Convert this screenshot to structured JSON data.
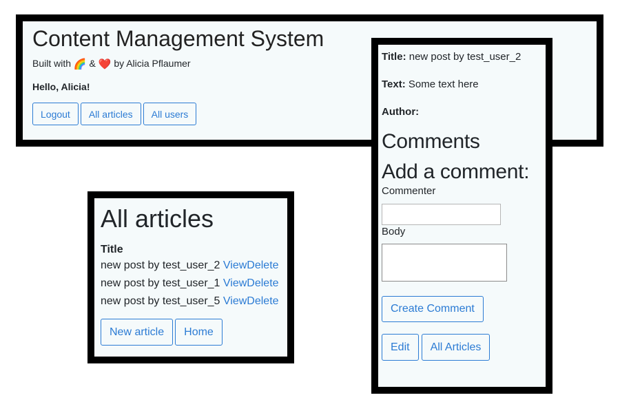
{
  "header": {
    "title": "Content Management System",
    "built_with_prefix": "Built with",
    "rainbow_emoji": "🌈",
    "ampersand": "&",
    "heart_emoji": "❤️",
    "built_with_suffix": "by Alicia Pflaumer",
    "greeting": "Hello, Alicia!",
    "buttons": {
      "logout": "Logout",
      "all_articles": "All articles",
      "all_users": "All users"
    }
  },
  "articles": {
    "heading": "All articles",
    "column_title": "Title",
    "rows": [
      {
        "title": "new post by test_user_2",
        "view": "View",
        "delete": "Delete"
      },
      {
        "title": "new post by test_user_1",
        "view": "View",
        "delete": "Delete"
      },
      {
        "title": "new post by test_user_5",
        "view": "View",
        "delete": "Delete"
      }
    ],
    "buttons": {
      "new_article": "New article",
      "home": "Home"
    }
  },
  "detail": {
    "title_key": "Title:",
    "title_value": "new post by test_user_2",
    "text_key": "Text:",
    "text_value": "Some text here",
    "author_key": "Author:",
    "author_value": "",
    "comments_heading": "Comments",
    "add_comment_heading": "Add a comment:",
    "commenter_label": "Commenter",
    "commenter_value": "",
    "body_label": "Body",
    "body_value": "",
    "buttons": {
      "create_comment": "Create Comment",
      "edit": "Edit",
      "all_articles": "All Articles"
    }
  },
  "colors": {
    "accent": "#2b7bd4",
    "panel_bg": "#f5fafb",
    "frame": "#000000",
    "heart": "#e0182a"
  }
}
